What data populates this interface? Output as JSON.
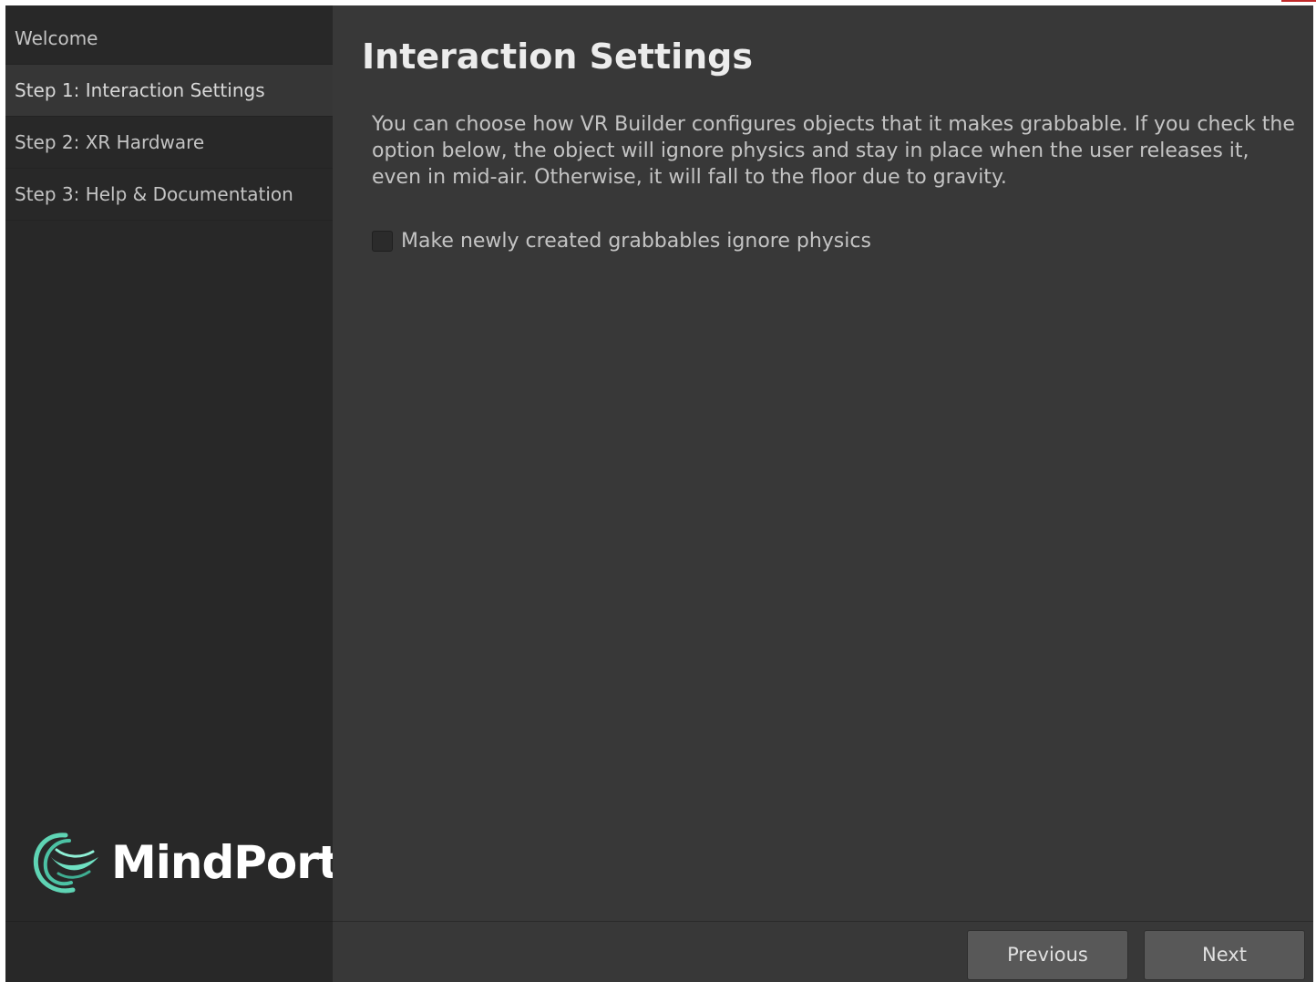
{
  "sidebar": {
    "items": [
      {
        "label": "Welcome"
      },
      {
        "label": "Step 1: Interaction Settings",
        "selected": true
      },
      {
        "label": "Step 2: XR Hardware"
      },
      {
        "label": "Step 3: Help & Documentation"
      }
    ],
    "logo": {
      "icon": "mindport-logo-icon",
      "text": "MindPort",
      "accent_color": "#5fd4b4"
    }
  },
  "main": {
    "title": "Interaction Settings",
    "description": "You can choose how VR Builder configures objects that it makes grabbable. If you check the option below, the object will ignore physics and stay in place when the user releases it, even in mid-air. Otherwise, it will fall to the floor due to gravity.",
    "option": {
      "label": "Make newly created grabbables ignore physics",
      "checked": false
    }
  },
  "footer": {
    "previous_label": "Previous",
    "next_label": "Next"
  }
}
